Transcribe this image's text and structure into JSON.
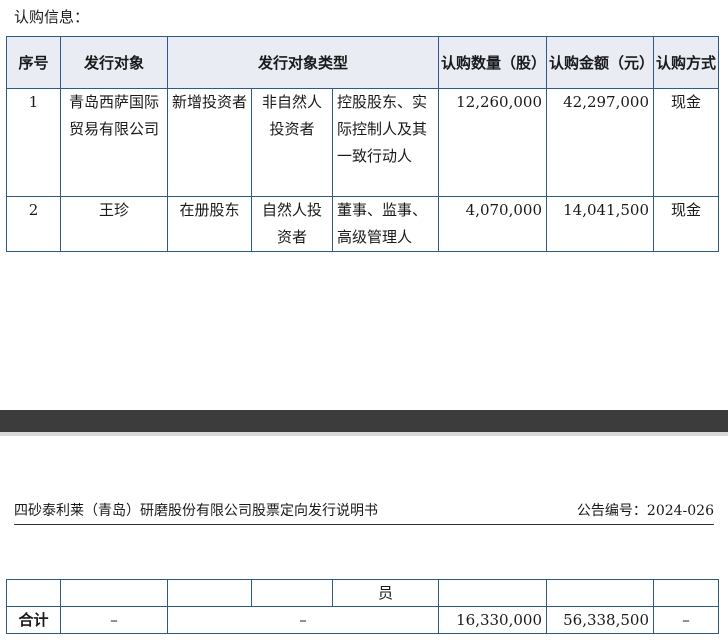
{
  "intro": "认购信息：",
  "table": {
    "headers": {
      "seq": "序号",
      "target": "发行对象",
      "type": "发行对象类型",
      "qty": "认购数量（股）",
      "amount": "认购金额（元）",
      "method": "认购方式"
    },
    "rows": [
      {
        "seq": "1",
        "target": "青岛西萨国际贸易有限公司",
        "type1": "新增投资者",
        "type2": "非自然人投资者",
        "type3": "控股股东、实际控制人及其一致行动人",
        "qty": "12,260,000",
        "amount": "42,297,000",
        "method": "现金"
      },
      {
        "seq": "2",
        "target": "王珍",
        "type1": "在册股东",
        "type2": "自然人投资者",
        "type3": "董事、监事、高级管理人",
        "qty": "4,070,000",
        "amount": "14,041,500",
        "method": "现金"
      }
    ]
  },
  "page_header": {
    "left": "四砂泰利莱（青岛）研磨股份有限公司股票定向发行说明书",
    "right": "公告编号：2024-026"
  },
  "continuation": {
    "carry_text": "员",
    "total_label": "合计",
    "dash": "–",
    "total_qty": "16,330,000",
    "total_amount": "56,338,500"
  }
}
